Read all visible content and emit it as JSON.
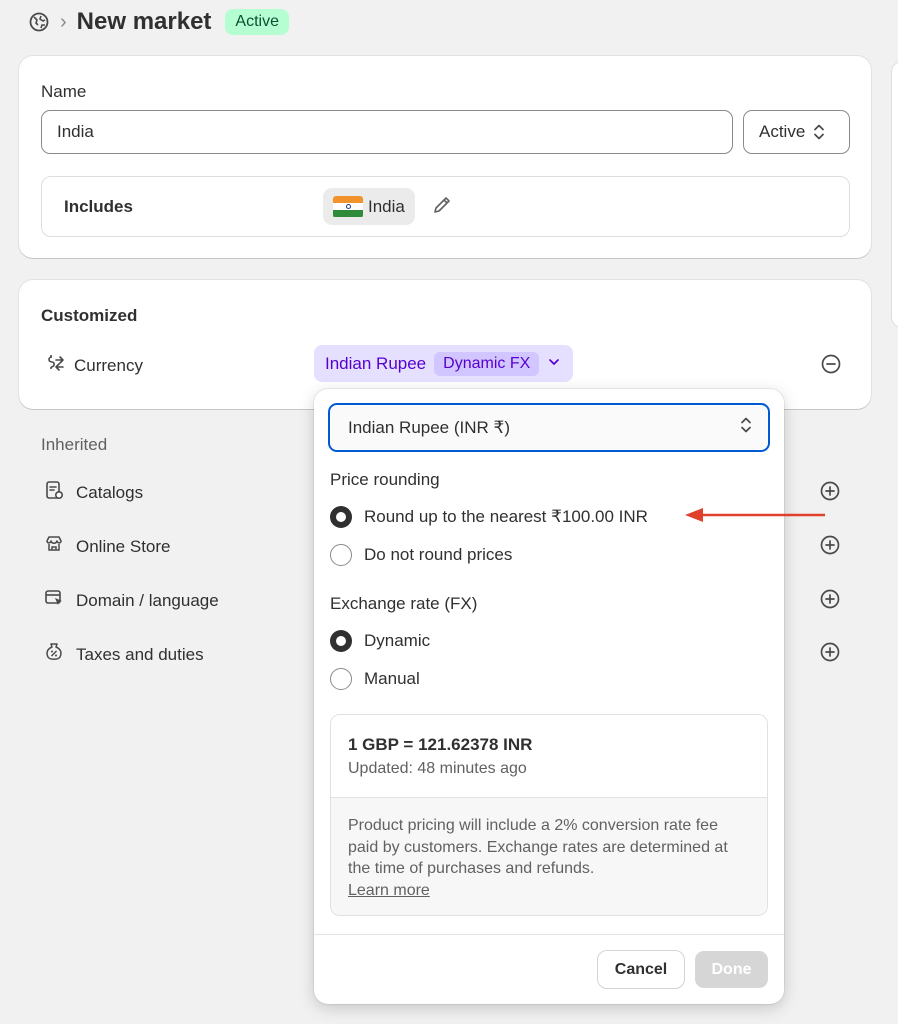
{
  "header": {
    "title": "New market",
    "status_badge": "Active"
  },
  "market_card": {
    "name_label": "Name",
    "name_value": "India",
    "status_select": "Active",
    "includes_label": "Includes",
    "country_chip": "India"
  },
  "customized_card": {
    "heading": "Customized",
    "currency_label": "Currency",
    "currency_chip": "Indian Rupee",
    "fx_tag": "Dynamic FX"
  },
  "inherited": {
    "heading": "Inherited",
    "items": [
      {
        "label": "Catalogs",
        "icon": "catalog-icon"
      },
      {
        "label": "Online Store",
        "icon": "store-icon"
      },
      {
        "label": "Domain / language",
        "icon": "domain-icon"
      },
      {
        "label": "Taxes and duties",
        "icon": "taxes-icon"
      }
    ]
  },
  "popover": {
    "currency_select": "Indian Rupee (INR ₹)",
    "price_rounding_label": "Price rounding",
    "rounding_options": [
      {
        "label": "Round up to the nearest ₹100.00 INR",
        "selected": true
      },
      {
        "label": "Do not round prices",
        "selected": false
      }
    ],
    "exchange_label": "Exchange rate (FX)",
    "exchange_options": [
      {
        "label": "Dynamic",
        "selected": true
      },
      {
        "label": "Manual",
        "selected": false
      }
    ],
    "rate_value": "1 GBP = 121.62378 INR",
    "rate_updated": "Updated: 48 minutes ago",
    "rate_note": "Product pricing will include a 2% conversion rate fee paid by customers. Exchange rates are determined at the time of purchases and refunds.",
    "learn_more": "Learn more",
    "cancel_label": "Cancel",
    "done_label": "Done"
  },
  "colors": {
    "accent_blue": "#005bd3",
    "badge_green": "#b4fed2",
    "currency_purple": "#5700d1",
    "annotation_red": "#e0412b"
  }
}
